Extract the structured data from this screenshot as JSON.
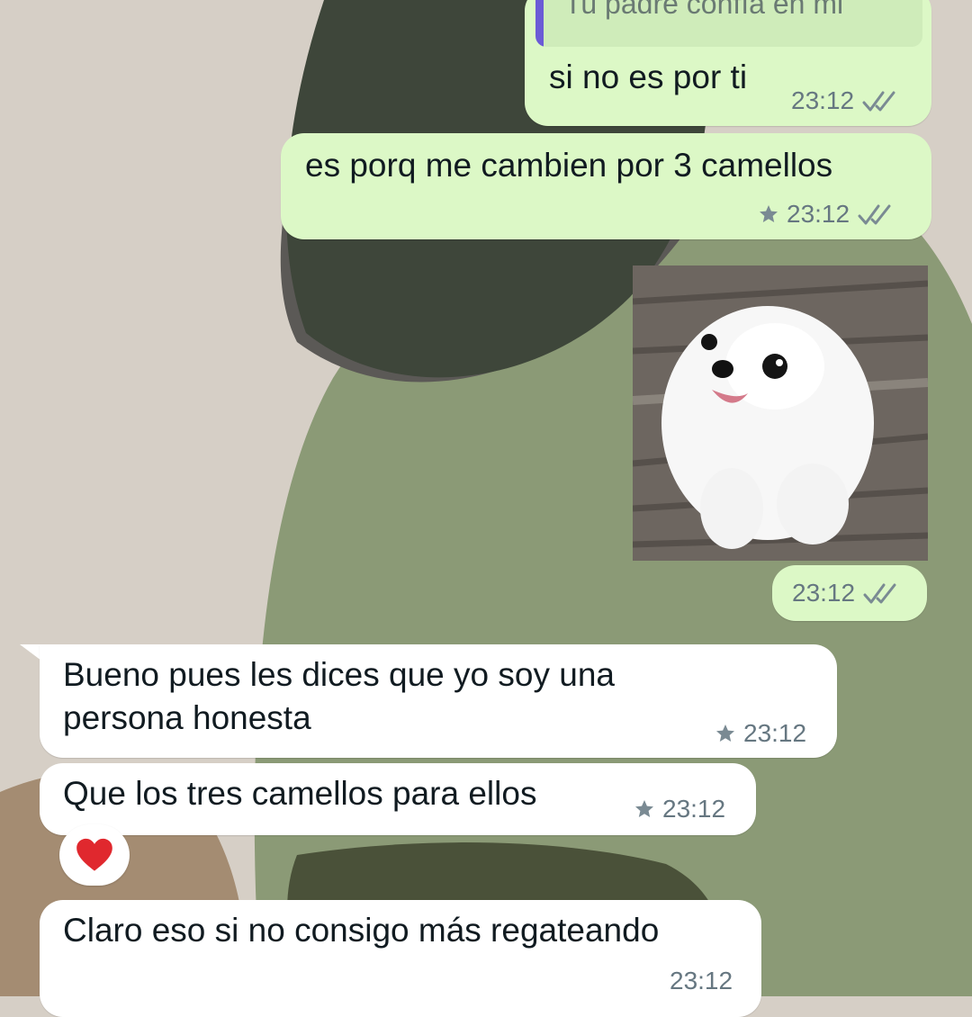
{
  "colors": {
    "outgoing_bubble": "#dcf8c6",
    "incoming_bubble": "#ffffff",
    "read_ticks": "#7a8a93",
    "quote_bar": "#6b5bd6"
  },
  "messages": [
    {
      "direction": "outgoing",
      "quoted_text": "Tu padre confía en mi",
      "text": "si no es por ti",
      "time": "23:12",
      "status_icon": "double-check-icon"
    },
    {
      "direction": "outgoing",
      "text": "es porq me cambien por 3 camellos",
      "time": "23:12",
      "starred": true,
      "status_icon": "double-check-icon"
    },
    {
      "direction": "outgoing",
      "type": "image",
      "image_subject": "white pomeranian puppy",
      "time": "23:12",
      "status_icon": "double-check-icon"
    },
    {
      "direction": "incoming",
      "text_line1": "Bueno pues les dices que yo soy una",
      "text_line2": "persona honesta",
      "time": "23:12",
      "starred": true
    },
    {
      "direction": "incoming",
      "text": "Que los tres camellos para ellos",
      "time": "23:12",
      "starred": true,
      "reaction": "heart-icon"
    },
    {
      "direction": "incoming",
      "text": "Claro eso si no consigo más regateando",
      "time": "23:12"
    }
  ]
}
